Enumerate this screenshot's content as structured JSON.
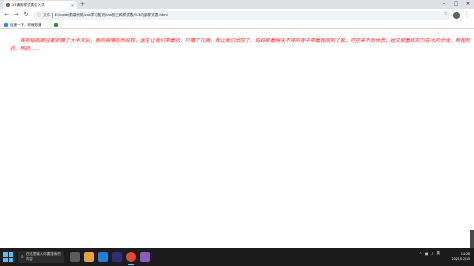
{
  "browser": {
    "tab_title": "25通用样式表引入式",
    "new_tab": "+",
    "url": "E:/code/前端代码/css学习知识/css的三种样式表/5.3内部样式表.html",
    "security_label": "文件",
    "window_controls": [
      "–",
      "□",
      "✕"
    ]
  },
  "bookmarks": {
    "items": [
      {
        "label": "百度一下，你就知道",
        "color": "#3388ff"
      },
      {
        "label": "",
        "color": "#2b9939"
      }
    ]
  },
  "page": {
    "paragraph": "等到稻和豌豆都折腾了大半天后，我的病情有所好转，医生让我们带着药，叮嘱了几遍，我让我们出院了。妈妈推着病床不停的身子带着我回到了家，可还来不及休息，她又推着砍的刀在水的步伐，帮我煎药、熬药……",
    "text_color": "#ff2020"
  },
  "taskbar": {
    "search_placeholder": "在这里输入你要搜索的内容",
    "clock_time": "14:28",
    "clock_date": "2021/12/15",
    "tray_lang": "英"
  }
}
